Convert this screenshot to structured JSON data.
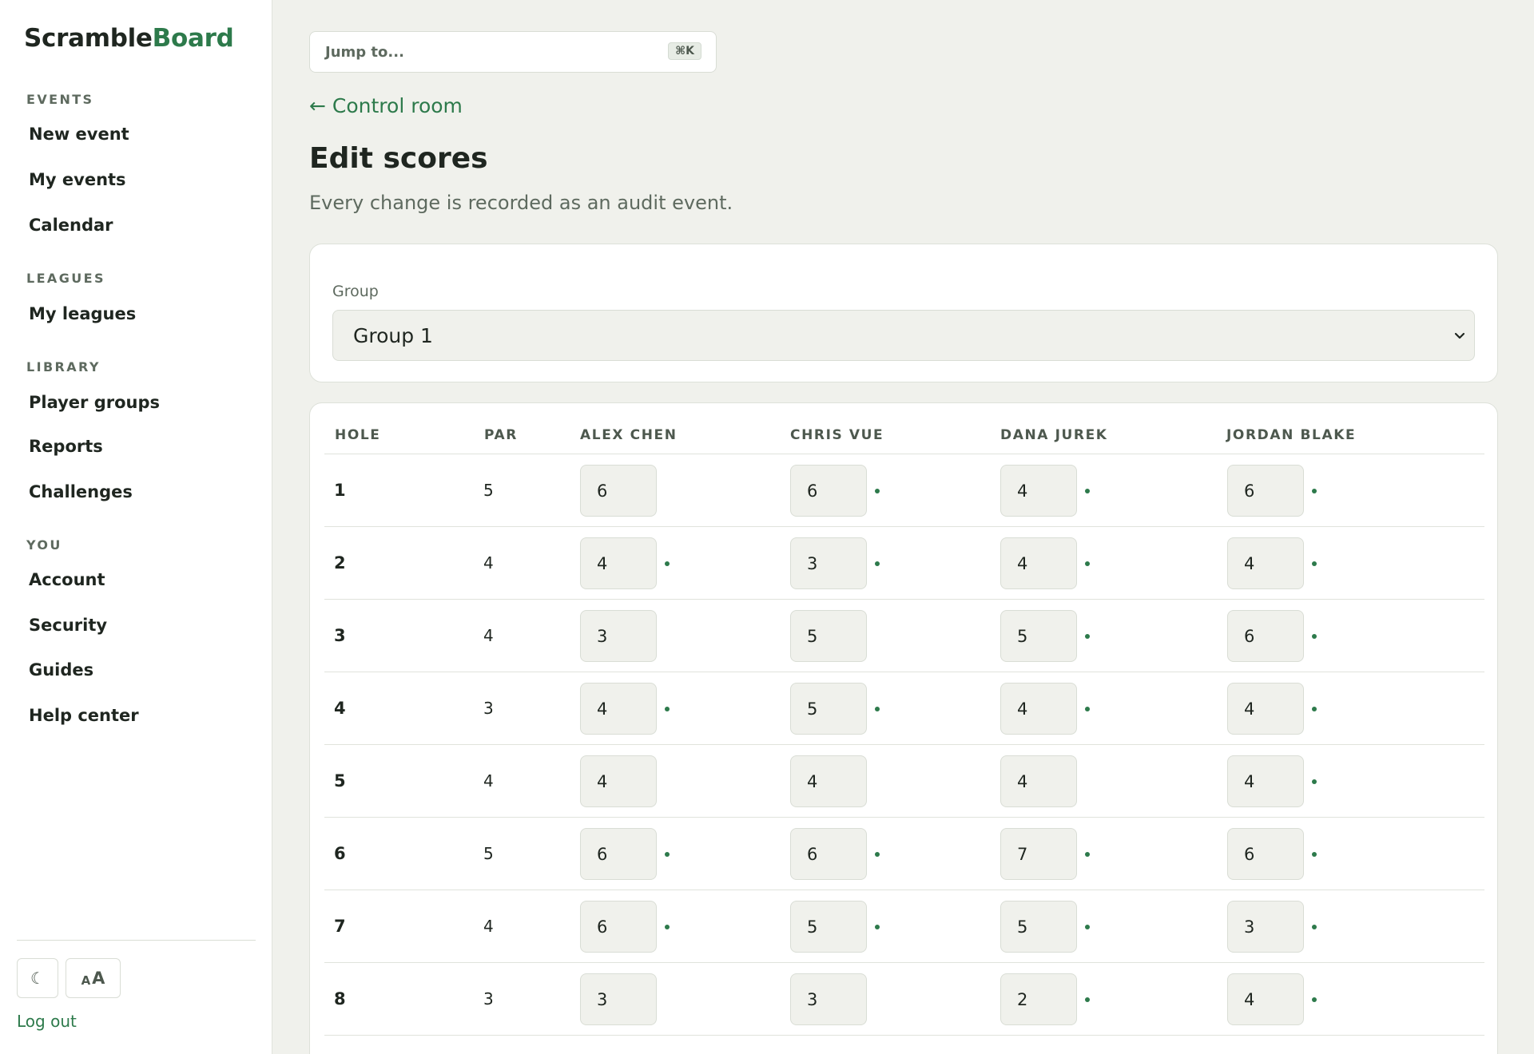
{
  "brand": {
    "part1": "Scramble",
    "part2": "Board"
  },
  "sidebar": {
    "sections": [
      {
        "label": "EVENTS",
        "items": [
          "New event",
          "My events",
          "Calendar"
        ]
      },
      {
        "label": "LEAGUES",
        "items": [
          "My leagues"
        ]
      },
      {
        "label": "LIBRARY",
        "items": [
          "Player groups",
          "Reports",
          "Challenges"
        ]
      },
      {
        "label": "YOU",
        "items": [
          "Account",
          "Security",
          "Guides",
          "Help center"
        ]
      }
    ],
    "theme_icon": "☾",
    "text_size_small": "A",
    "text_size_big": "A",
    "logout": "Log out"
  },
  "search": {
    "placeholder": "Jump to...",
    "shortcut": "⌘K"
  },
  "back_link": "← Control room",
  "page": {
    "title": "Edit scores",
    "subtitle": "Every change is recorded as an audit event."
  },
  "group": {
    "label": "Group",
    "selected": "Group 1"
  },
  "table": {
    "headers": [
      "HOLE",
      "PAR",
      "ALEX CHEN",
      "CHRIS VUE",
      "DANA JUREK",
      "JORDAN BLAKE"
    ],
    "rows": [
      {
        "hole": "1",
        "par": "5",
        "scores": [
          "6",
          "6",
          "4",
          "6"
        ],
        "changed": [
          false,
          true,
          true,
          true
        ]
      },
      {
        "hole": "2",
        "par": "4",
        "scores": [
          "4",
          "3",
          "4",
          "4"
        ],
        "changed": [
          true,
          true,
          true,
          true
        ]
      },
      {
        "hole": "3",
        "par": "4",
        "scores": [
          "3",
          "5",
          "5",
          "6"
        ],
        "changed": [
          false,
          false,
          true,
          true
        ]
      },
      {
        "hole": "4",
        "par": "3",
        "scores": [
          "4",
          "5",
          "4",
          "4"
        ],
        "changed": [
          true,
          true,
          true,
          true
        ]
      },
      {
        "hole": "5",
        "par": "4",
        "scores": [
          "4",
          "4",
          "4",
          "4"
        ],
        "changed": [
          false,
          false,
          false,
          true
        ]
      },
      {
        "hole": "6",
        "par": "5",
        "scores": [
          "6",
          "6",
          "7",
          "6"
        ],
        "changed": [
          true,
          true,
          true,
          true
        ]
      },
      {
        "hole": "7",
        "par": "4",
        "scores": [
          "6",
          "5",
          "5",
          "3"
        ],
        "changed": [
          true,
          true,
          true,
          true
        ]
      },
      {
        "hole": "8",
        "par": "3",
        "scores": [
          "3",
          "3",
          "2",
          "4"
        ],
        "changed": [
          false,
          false,
          true,
          true
        ]
      }
    ]
  },
  "colors": {
    "accent": "#2d7a4b",
    "background": "#f0f1ec",
    "surface": "#ffffff"
  }
}
